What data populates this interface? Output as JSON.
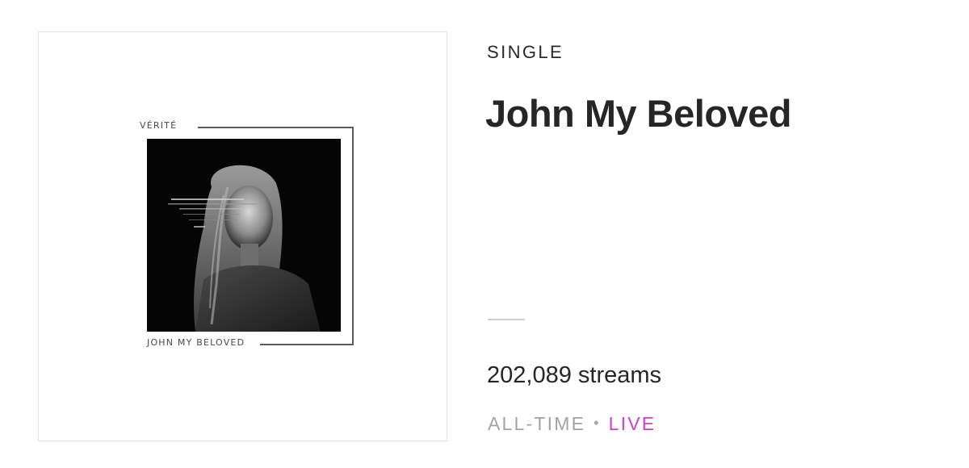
{
  "album_art": {
    "artist": "VÉRITÉ",
    "title": "JOHN MY BELOVED"
  },
  "release": {
    "type_label": "SINGLE",
    "title": "John My Beloved"
  },
  "stats": {
    "streams_text": "202,089 streams",
    "period_label": "ALL-TIME",
    "separator": "•",
    "live_label": "LIVE"
  },
  "colors": {
    "live_accent": "#d13fc4",
    "muted_text": "#a3a3a3",
    "primary_text": "#262626"
  }
}
